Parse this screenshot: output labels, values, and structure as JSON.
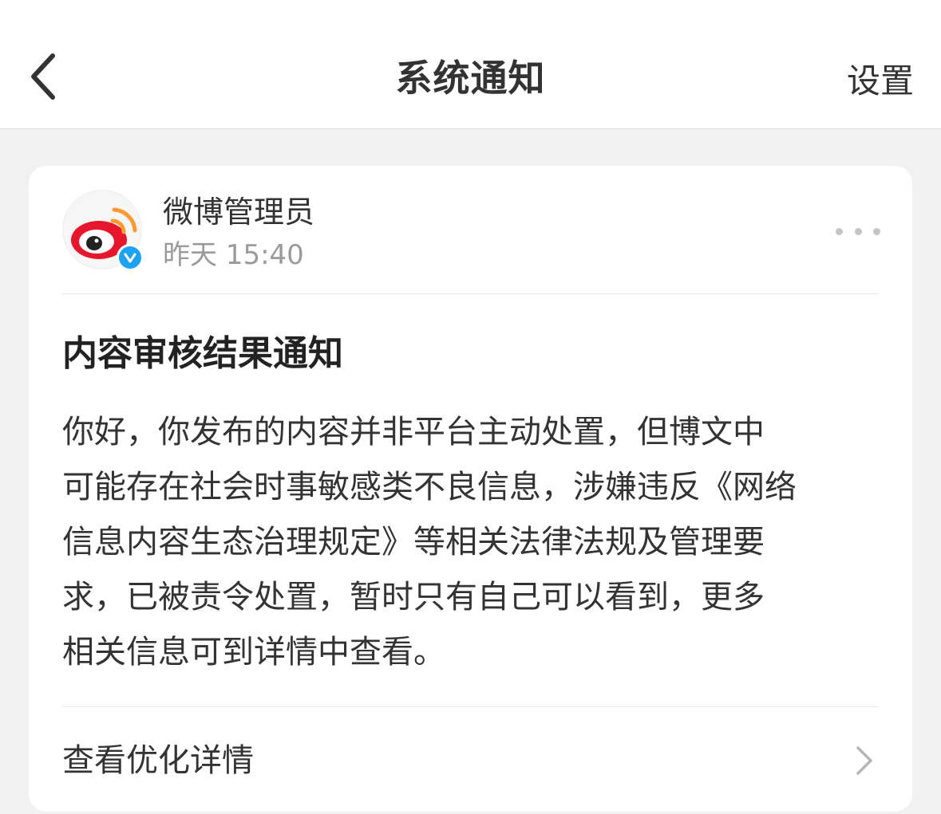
{
  "nav": {
    "title": "系统通知",
    "settings_label": "设置"
  },
  "message": {
    "sender": "微博管理员",
    "timestamp": "昨天 15:40",
    "title": "内容审核结果通知",
    "body_lines": [
      "你好，你发布的内容并非平台主动处置，但博文中",
      "可能存在社会时事敏感类不良信息，涉嫌违反《网络",
      "信息内容生态治理规定》等相关法律法规及管理要",
      "求，已被责令处置，暂时只有自己可以看到，更多",
      "相关信息可到详情中查看。"
    ],
    "detail_label": "查看优化详情"
  },
  "colors": {
    "brand_red": "#e6162d",
    "brand_orange": "#ff9933",
    "verified_blue": "#1da1f2"
  },
  "icons": {
    "back": "chevron-left-icon",
    "avatar": "weibo-logo",
    "verified": "verified-badge-icon",
    "more": "more-dots-icon",
    "detail_arrow": "chevron-right-icon"
  }
}
